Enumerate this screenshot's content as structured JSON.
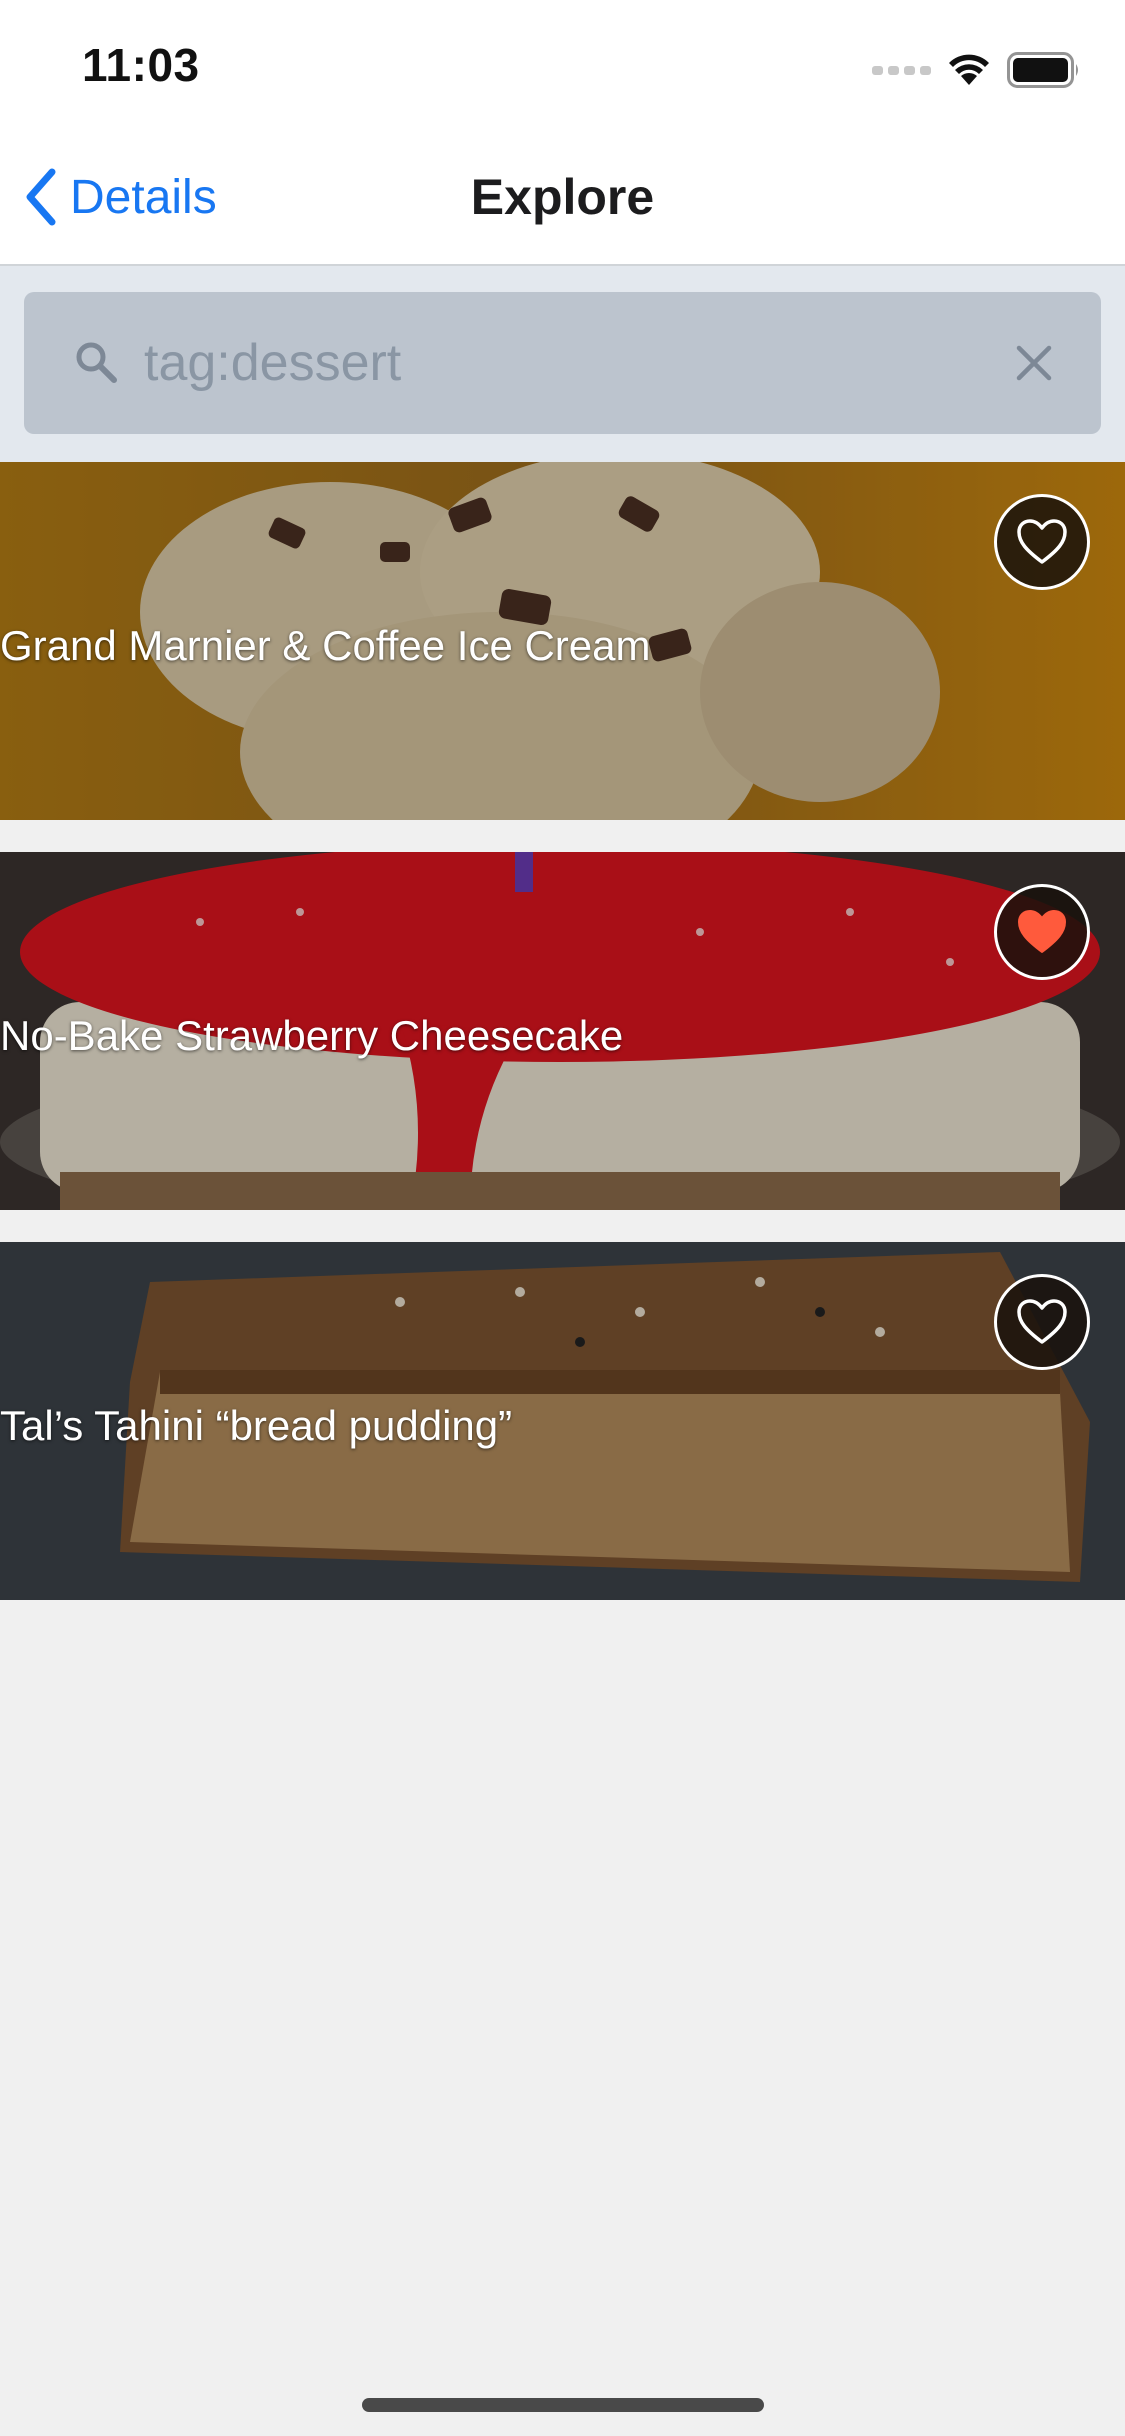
{
  "status_bar": {
    "time": "11:03",
    "icons": [
      "signal-icon",
      "wifi-icon",
      "battery-icon"
    ]
  },
  "nav": {
    "back_label": "Details",
    "title": "Explore",
    "back_icon": "chevron-left-icon"
  },
  "search": {
    "value": "tag:dessert",
    "search_icon": "search-icon",
    "clear_icon": "close-icon"
  },
  "recipes": [
    {
      "title": "Grand Marnier & Coffee Ice Cream",
      "favorited": false
    },
    {
      "title": "No-Bake Strawberry Cheesecake",
      "favorited": true
    },
    {
      "title": "Tal’s Tahini “bread pudding”",
      "favorited": false
    }
  ],
  "colors": {
    "accent": "#1877f2",
    "favorite_active": "#ff5a3c",
    "background": "#f0f0f0",
    "search_area": "#e3e8ee",
    "search_box": "#bcc4ce"
  }
}
